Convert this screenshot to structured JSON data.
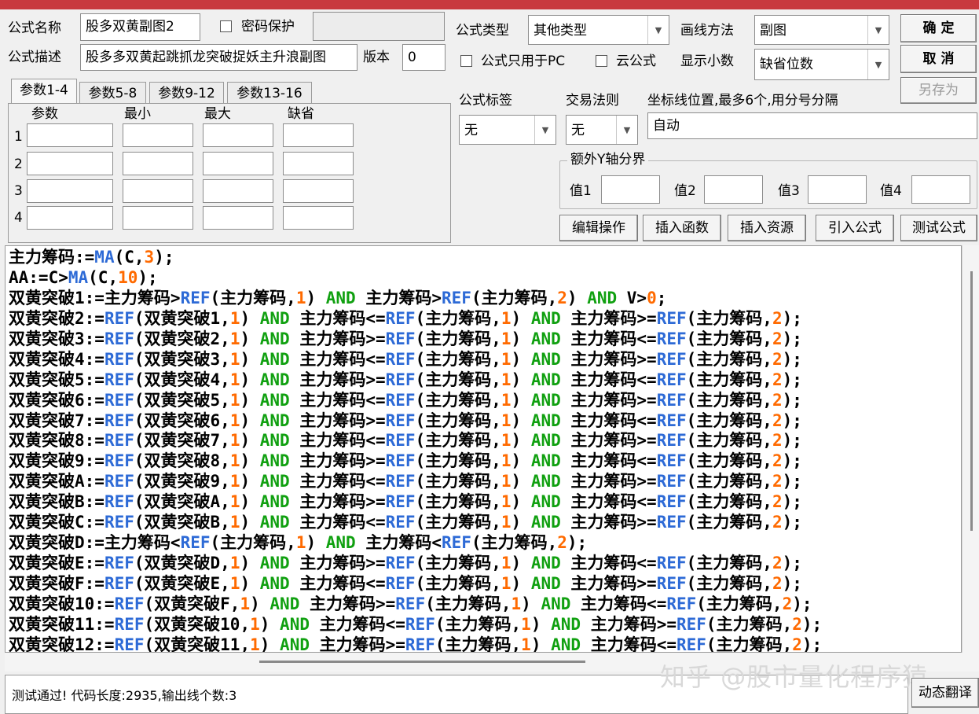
{
  "window": {
    "title_color": "#c8393f"
  },
  "formula": {
    "name_label": "公式名称",
    "name_value": "股多双黄副图2",
    "password_label": "密码保护",
    "desc_label": "公式描述",
    "desc_value": "股多多双黄起跳抓龙突破捉妖主升浪副图",
    "version_label": "版本",
    "version_value": "0",
    "type_label": "公式类型",
    "type_value": "其他类型",
    "draw_label": "画线方法",
    "draw_value": "副图",
    "pc_only_label": "公式只用于PC",
    "cloud_label": "云公式",
    "decimal_label": "显示小数",
    "decimal_value": "缺省位数",
    "tag_label": "公式标签",
    "tag_value": "无",
    "trade_label": "交易法则",
    "trade_value": "无",
    "axis_label": "坐标线位置,最多6个,用分号分隔",
    "axis_value": "自动",
    "yaxis_group": "额外Y轴分界",
    "y1_label": "值1",
    "y2_label": "值2",
    "y3_label": "值3",
    "y4_label": "值4"
  },
  "buttons": {
    "ok": "确 定",
    "cancel": "取 消",
    "saveas": "另存为",
    "edit": "编辑操作",
    "insert_func": "插入函数",
    "insert_res": "插入资源",
    "import": "引入公式",
    "test": "测试公式",
    "translate": "动态翻译"
  },
  "params": {
    "tabs": [
      "参数1-4",
      "参数5-8",
      "参数9-12",
      "参数13-16"
    ],
    "headers": [
      "参数",
      "最小",
      "最大",
      "缺省"
    ],
    "rows": [
      "1",
      "2",
      "3",
      "4"
    ]
  },
  "code_lines": [
    "主力筹码:=MA(C,3);",
    "AA:=C>MA(C,10);",
    "双黄突破1:=主力筹码>REF(主力筹码,1) AND 主力筹码>REF(主力筹码,2) AND V>0;",
    "双黄突破2:=REF(双黄突破1,1) AND 主力筹码<=REF(主力筹码,1) AND 主力筹码>=REF(主力筹码,2);",
    "双黄突破3:=REF(双黄突破2,1) AND 主力筹码>=REF(主力筹码,1) AND 主力筹码<=REF(主力筹码,2);",
    "双黄突破4:=REF(双黄突破3,1) AND 主力筹码<=REF(主力筹码,1) AND 主力筹码>=REF(主力筹码,2);",
    "双黄突破5:=REF(双黄突破4,1) AND 主力筹码>=REF(主力筹码,1) AND 主力筹码<=REF(主力筹码,2);",
    "双黄突破6:=REF(双黄突破5,1) AND 主力筹码<=REF(主力筹码,1) AND 主力筹码>=REF(主力筹码,2);",
    "双黄突破7:=REF(双黄突破6,1) AND 主力筹码>=REF(主力筹码,1) AND 主力筹码<=REF(主力筹码,2);",
    "双黄突破8:=REF(双黄突破7,1) AND 主力筹码<=REF(主力筹码,1) AND 主力筹码>=REF(主力筹码,2);",
    "双黄突破9:=REF(双黄突破8,1) AND 主力筹码>=REF(主力筹码,1) AND 主力筹码<=REF(主力筹码,2);",
    "双黄突破A:=REF(双黄突破9,1) AND 主力筹码<=REF(主力筹码,1) AND 主力筹码>=REF(主力筹码,2);",
    "双黄突破B:=REF(双黄突破A,1) AND 主力筹码>=REF(主力筹码,1) AND 主力筹码<=REF(主力筹码,2);",
    "双黄突破C:=REF(双黄突破B,1) AND 主力筹码<=REF(主力筹码,1) AND 主力筹码>=REF(主力筹码,2);",
    "双黄突破D:=主力筹码<REF(主力筹码,1) AND 主力筹码<REF(主力筹码,2);",
    "双黄突破E:=REF(双黄突破D,1) AND 主力筹码>=REF(主力筹码,1) AND 主力筹码<=REF(主力筹码,2);",
    "双黄突破F:=REF(双黄突破E,1) AND 主力筹码<=REF(主力筹码,1) AND 主力筹码>=REF(主力筹码,2);",
    "双黄突破10:=REF(双黄突破F,1) AND 主力筹码>=REF(主力筹码,1) AND 主力筹码<=REF(主力筹码,2);",
    "双黄突破11:=REF(双黄突破10,1) AND 主力筹码<=REF(主力筹码,1) AND 主力筹码>=REF(主力筹码,2);",
    "双黄突破12:=REF(双黄突破11,1) AND 主力筹码>=REF(主力筹码,1) AND 主力筹码<=REF(主力筹码,2);"
  ],
  "status_text": "测试通过! 代码长度:2935,输出线个数:3",
  "watermark": "知乎 @股市量化程序猿",
  "colors": {
    "function": "#2d6ad6",
    "keyword": "#10a010",
    "number": "#ff6a00"
  }
}
